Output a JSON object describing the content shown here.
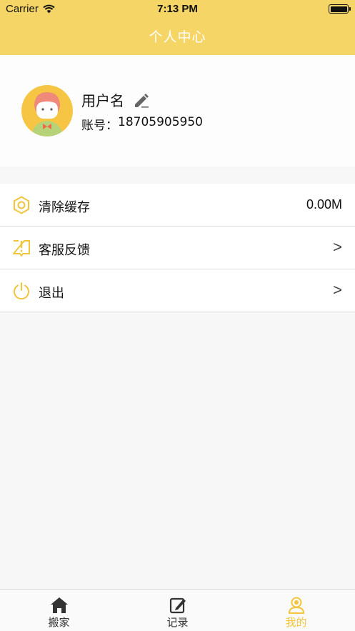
{
  "status_bar": {
    "carrier": "Carrier",
    "time": "7:13 PM"
  },
  "header": {
    "title": "个人中心"
  },
  "profile": {
    "username": "用户名",
    "account_label": "账号：",
    "account_number": "18705905950"
  },
  "menu": {
    "clear_cache": {
      "label": "清除缓存",
      "value": "0.00M"
    },
    "feedback": {
      "label": "客服反馈",
      "chevron": ">"
    },
    "logout": {
      "label": "退出",
      "chevron": ">"
    }
  },
  "tabbar": {
    "items": [
      {
        "label": "搬家",
        "icon": "home-icon"
      },
      {
        "label": "记录",
        "icon": "edit-note-icon"
      },
      {
        "label": "我的",
        "icon": "user-icon",
        "active": true
      }
    ]
  },
  "colors": {
    "accent": "#f5d565",
    "active_tab": "#f2c53d",
    "icon_yellow": "#f2c53d"
  }
}
